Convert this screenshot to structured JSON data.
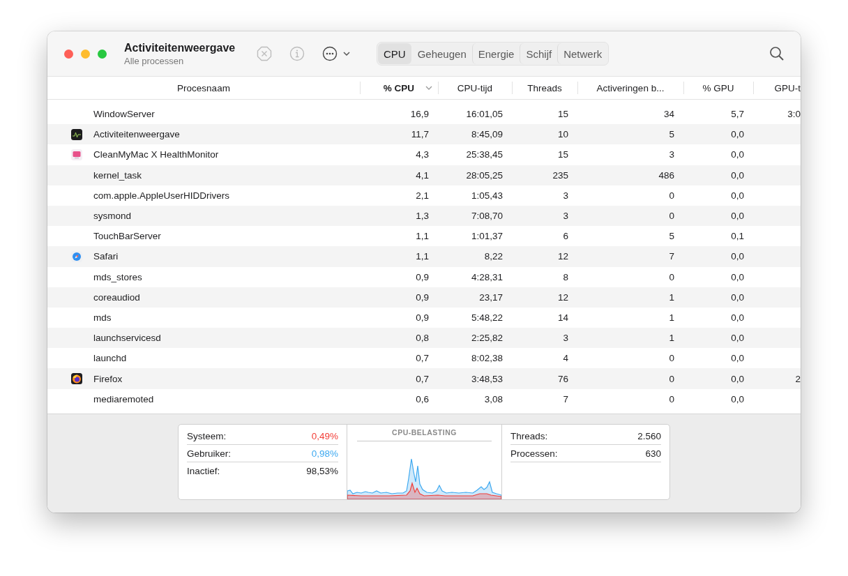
{
  "window": {
    "title": "Activiteitenweergave",
    "subtitle": "Alle processen"
  },
  "tabs": [
    {
      "label": "CPU",
      "selected": true
    },
    {
      "label": "Geheugen",
      "selected": false
    },
    {
      "label": "Energie",
      "selected": false
    },
    {
      "label": "Schijf",
      "selected": false
    },
    {
      "label": "Netwerk",
      "selected": false
    }
  ],
  "table": {
    "columns": [
      {
        "label": "Procesnaam",
        "sorted": false
      },
      {
        "label": "% CPU",
        "sorted": true
      },
      {
        "label": "CPU-tijd",
        "sorted": false
      },
      {
        "label": "Threads",
        "sorted": false
      },
      {
        "label": "Activeringen b...",
        "sorted": false
      },
      {
        "label": "% GPU",
        "sorted": false
      },
      {
        "label": "GPU-t",
        "sorted": false
      }
    ],
    "rows": [
      {
        "kind": "none",
        "cells": [
          "WindowServer",
          "16,9",
          "16:01,05",
          "15",
          "34",
          "5,7",
          "3:0"
        ]
      },
      {
        "kind": "monitor",
        "cells": [
          "Activiteitenweergave",
          "11,7",
          "8:45,09",
          "10",
          "5",
          "0,0",
          ""
        ]
      },
      {
        "kind": "cleaner",
        "cells": [
          "CleanMyMac X HealthMonitor",
          "4,3",
          "25:38,45",
          "15",
          "3",
          "0,0",
          ""
        ]
      },
      {
        "kind": "none",
        "cells": [
          "kernel_task",
          "4,1",
          "28:05,25",
          "235",
          "486",
          "0,0",
          ""
        ]
      },
      {
        "kind": "none",
        "cells": [
          "com.apple.AppleUserHIDDrivers",
          "2,1",
          "1:05,43",
          "3",
          "0",
          "0,0",
          ""
        ]
      },
      {
        "kind": "none",
        "cells": [
          "sysmond",
          "1,3",
          "7:08,70",
          "3",
          "0",
          "0,0",
          ""
        ]
      },
      {
        "kind": "none",
        "cells": [
          "TouchBarServer",
          "1,1",
          "1:01,37",
          "6",
          "5",
          "0,1",
          ""
        ]
      },
      {
        "kind": "compass",
        "cells": [
          "Safari",
          "1,1",
          "8,22",
          "12",
          "7",
          "0,0",
          ""
        ]
      },
      {
        "kind": "none",
        "cells": [
          "mds_stores",
          "0,9",
          "4:28,31",
          "8",
          "0",
          "0,0",
          ""
        ]
      },
      {
        "kind": "none",
        "cells": [
          "coreaudiod",
          "0,9",
          "23,17",
          "12",
          "1",
          "0,0",
          ""
        ]
      },
      {
        "kind": "none",
        "cells": [
          "mds",
          "0,9",
          "5:48,22",
          "14",
          "1",
          "0,0",
          ""
        ]
      },
      {
        "kind": "none",
        "cells": [
          "launchservicesd",
          "0,8",
          "2:25,82",
          "3",
          "1",
          "0,0",
          ""
        ]
      },
      {
        "kind": "none",
        "cells": [
          "launchd",
          "0,7",
          "8:02,38",
          "4",
          "0",
          "0,0",
          ""
        ]
      },
      {
        "kind": "fox",
        "cells": [
          "Firefox",
          "0,7",
          "3:48,53",
          "76",
          "0",
          "0,0",
          "2"
        ]
      },
      {
        "kind": "none",
        "cells": [
          "mediaremoted",
          "0,6",
          "3,08",
          "7",
          "0",
          "0,0",
          ""
        ]
      }
    ]
  },
  "summary": {
    "stats": [
      {
        "label": "Systeem:",
        "value": "0,49%",
        "color": "#f2403a"
      },
      {
        "label": "Gebruiker:",
        "value": "0,98%",
        "color": "#3ea9f0"
      },
      {
        "label": "Inactief:",
        "value": "98,53%",
        "color": "#1d1d1f"
      }
    ],
    "chart_title": "CPU-BELASTING",
    "counts": [
      {
        "label": "Threads:",
        "value": "2.560"
      },
      {
        "label": "Processen:",
        "value": "630"
      }
    ]
  }
}
